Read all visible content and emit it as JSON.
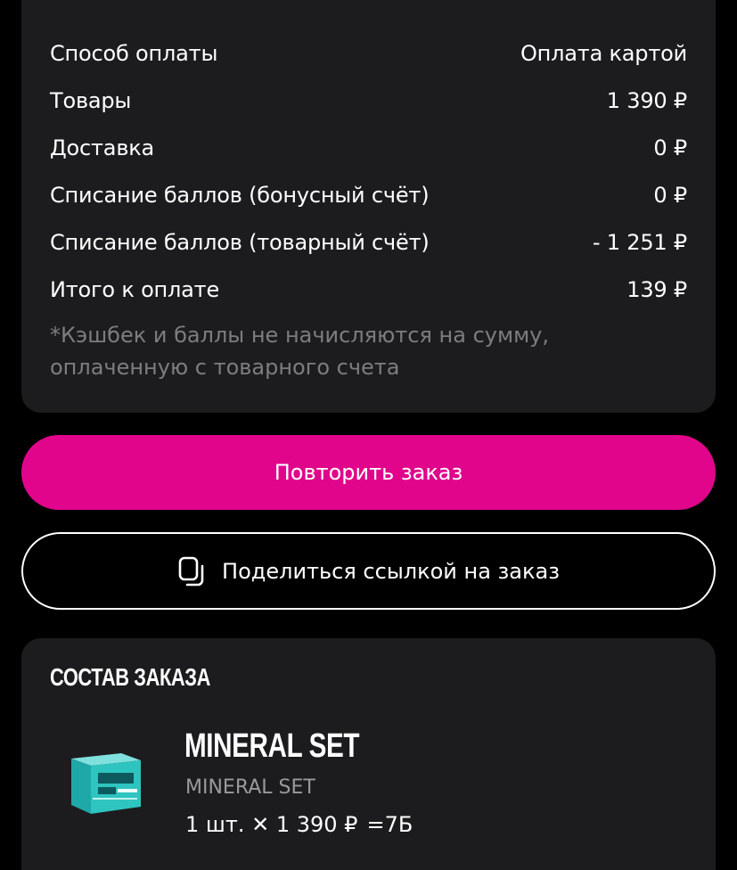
{
  "summary": {
    "rows": [
      {
        "label": "Способ оплаты",
        "value": "Оплата картой"
      },
      {
        "label": "Товары",
        "value": "1 390 ₽"
      },
      {
        "label": "Доставка",
        "value": "0 ₽"
      },
      {
        "label": "Списание баллов (бонусный счёт)",
        "value": "0 ₽"
      },
      {
        "label": "Списание баллов (товарный счёт)",
        "value": "- 1 251 ₽"
      },
      {
        "label": "Итого к оплате",
        "value": "139 ₽"
      }
    ],
    "note": "*Кэшбек и баллы не начисляются на сумму, оплаченную с товарного счета"
  },
  "actions": {
    "repeat_label": "Повторить заказ",
    "share_label": "Поделиться ссылкой на заказ",
    "share_icon": "copy-icon"
  },
  "order": {
    "title": "СОСТАВ ЗАКАЗА",
    "items": [
      {
        "name": "MINERAL SET",
        "subtitle": "MINERAL SET",
        "qty": "1 шт. ✕ 1 390 ₽",
        "points": "=7Б",
        "image_icon": "product-box-image"
      }
    ]
  },
  "colors": {
    "background": "#000000",
    "card": "#1c1c1e",
    "accent": "#e1058c",
    "muted_text": "#7d7d80"
  }
}
